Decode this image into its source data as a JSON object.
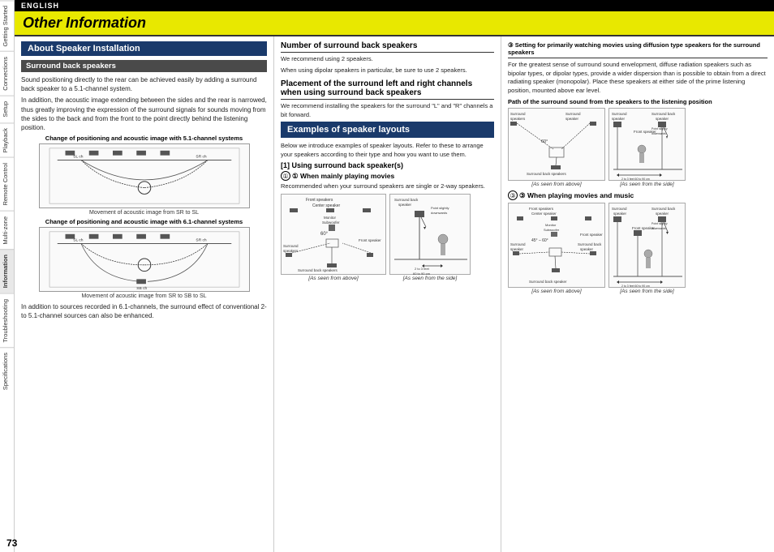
{
  "lang_badge": "ENGLISH",
  "page_title": "Other Information",
  "section_title": "About Speaker Installation",
  "subsection_surround": "Surround back speakers",
  "surround_text1": "Sound positioning directly to the rear can be achieved easily by adding a surround back speaker to a 5.1-channel system.",
  "surround_text2": "In addition, the acoustic image extending between the sides and the rear is narrowed, thus greatly improving the expression of the surround signals for sounds moving from the sides to the back and from the front to the point directly behind the listening position.",
  "diagram1_label": "Change of positioning and acoustic image with 5.1-channel systems",
  "movement1_label": "Movement of acoustic image from SR to SL",
  "diagram2_label": "Change of positioning and acoustic image with 6.1-channel systems",
  "movement2_label": "Movement of acoustic image from SR to SB to SL",
  "footer_text": "In addition to sources recorded in 6.1-channels, the surround effect of conventional 2- to 5.1-channel sources can also be enhanced.",
  "page_number": "73",
  "num_surround_heading": "Number of surround back speakers",
  "num_surround_text1": "We recommend using 2 speakers.",
  "num_surround_text2": "When using dipolar speakers in particular, be sure to use 2 speakers.",
  "placement_heading": "Placement of the surround left and right channels when using surround back speakers",
  "placement_text": "We recommend installing the speakers for the surround \"L\" and \"R\" channels a bit forward.",
  "examples_heading": "Examples of speaker layouts",
  "examples_intro": "Below we introduce examples of speaker layouts. Refer to these to arrange your speakers according to their type and how you want to use them.",
  "layout1_heading": "[1] Using surround back speaker(s)",
  "when_mainly_heading": "① When mainly playing movies",
  "when_mainly_text": "Recommended when your surround speakers are single or 2-way speakers.",
  "front_speakers_label": "Front speakers Center speaker",
  "monitor_label": "Monitor Subwoofer",
  "angle_60": "60°",
  "surround_speakers_label": "Surround speakers",
  "front_speaker_label": "Front speaker",
  "surround_back_label": "Surround back speaker",
  "distance_label": "2 to 3 feet 60 to 90 cm",
  "point_down_label": "Point slightly downwards",
  "as_seen_above_1": "[As seen from above]",
  "as_seen_side_1": "[As seen from the side]",
  "surround_back_speakers_label": "Surround back speakers",
  "setting_diffusion_heading": "③ Setting for primarily watching movies using diffusion type speakers for the surround speakers",
  "setting_diffusion_text": "For the greatest sense of surround sound envelopment, diffuse radiation speakers such as bipolar types, or dipolar types, provide a wider dispersion than is possible to obtain from a direct radiating speaker (monopolar). Place these speakers at either side of the prime listening position, mounted above ear level.",
  "path_heading": "Path of the surround sound from the speakers to the listening position",
  "surround_speakers_label2": "Surround speakers",
  "surround_speaker_side": "Surround speaker",
  "surround_back_speaker_side": "Surround back speaker",
  "front_speaker_side": "Front speaker",
  "distance_side": "2 to 3 feet 60 to 90 cm",
  "point_down_side": "Point slightly downwards",
  "as_seen_above_3": "[As seen from above]",
  "as_seen_side_3": "[As seen from the side]",
  "surround_back_speakers3": "Surround back speakers",
  "when_movies_music_heading": "③ When playing movies and music",
  "front_speakers2": "Front speakers Center speaker",
  "monitor2": "Monitor Subwoofer",
  "angle_45_60": "45° – 60°",
  "surround_speaker2": "Surround speaker",
  "surround_back_speaker2": "Surround back speaker",
  "front_speaker2": "Front speaker",
  "distance2": "2 to 3 feet 60 to 90 cm",
  "point_down2": "Point slightly downwards",
  "as_seen_above_4": "[As seen from above]",
  "as_seen_side_4": "[As seen from the side]",
  "surround_back_speaker3": "Surround back speaker",
  "sidebar_items": [
    "Getting Started",
    "Connections",
    "Setup",
    "Playback",
    "Remote Control",
    "Multi-zone",
    "Information",
    "Troubleshooting",
    "Specifications"
  ]
}
